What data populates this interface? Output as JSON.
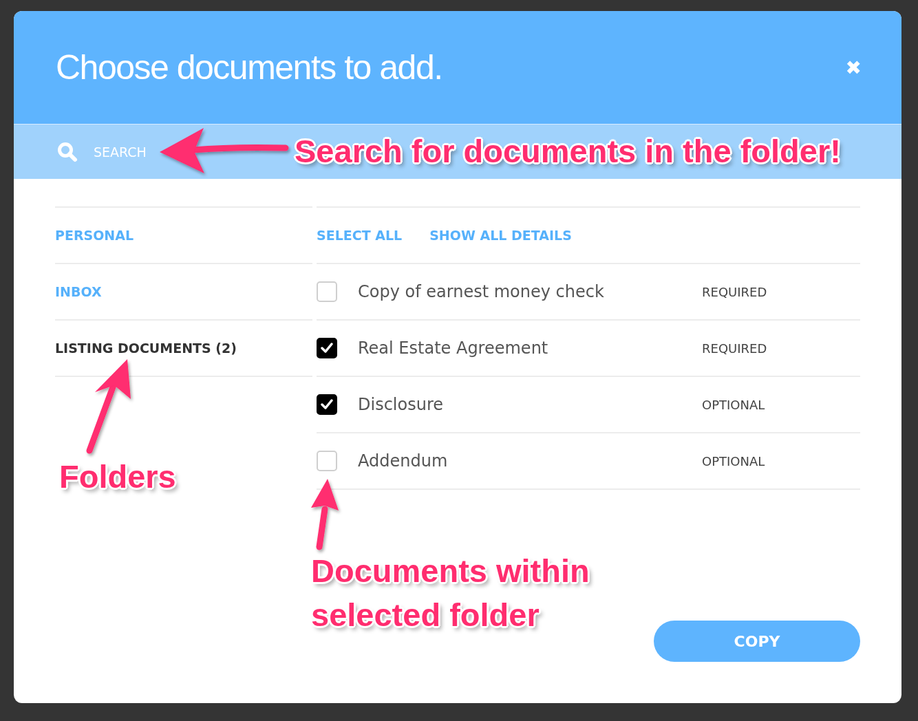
{
  "dialog": {
    "title": "Choose documents to add.",
    "close": "✖"
  },
  "search": {
    "placeholder": "SEARCH"
  },
  "folders": [
    {
      "label": "PERSONAL",
      "selected": false
    },
    {
      "label": "INBOX",
      "selected": false
    },
    {
      "label": "LISTING DOCUMENTS (2)",
      "selected": true
    }
  ],
  "actions": [
    "SELECT ALL",
    "SHOW ALL DETAILS"
  ],
  "documents": [
    {
      "name": "Copy of earnest money check",
      "requirement": "REQUIRED",
      "checked": false
    },
    {
      "name": "Real Estate Agreement",
      "requirement": "REQUIRED",
      "checked": true
    },
    {
      "name": "Disclosure",
      "requirement": "OPTIONAL",
      "checked": true
    },
    {
      "name": "Addendum",
      "requirement": "OPTIONAL",
      "checked": false
    }
  ],
  "copy_button": "COPY",
  "annotations": [
    {
      "kind": "search",
      "text": "Search for documents in the folder!"
    },
    {
      "kind": "folders",
      "text": "Folders"
    },
    {
      "kind": "documents",
      "text": "Documents within selected folder"
    }
  ]
}
